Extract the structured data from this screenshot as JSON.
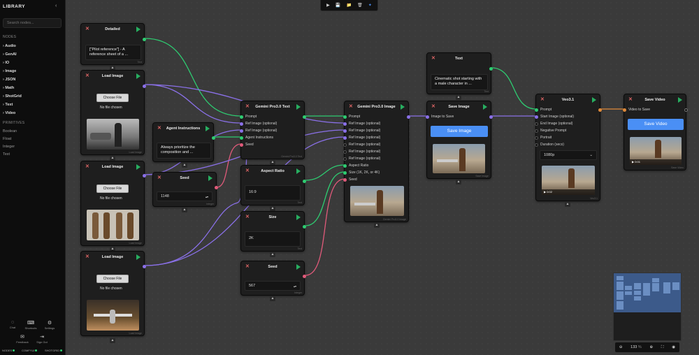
{
  "sidebar": {
    "title": "LIBRARY",
    "collapse_icon": "‹",
    "search_placeholder": "Search nodes...",
    "nodes_heading": "NODES",
    "items": [
      "Audio",
      "GenAI",
      "IO",
      "Image",
      "JSON",
      "Math",
      "ShotGrid",
      "Text",
      "Video"
    ],
    "primitives_heading": "PRIMITIVES",
    "primitives": [
      "Boolean",
      "Float",
      "Integer",
      "Text"
    ],
    "footer": [
      {
        "label": "Chat",
        "icon": "chat-icon"
      },
      {
        "label": "Shortcuts",
        "icon": "keyboard-icon"
      },
      {
        "label": "Settings",
        "icon": "gear-icon"
      },
      {
        "label": "Feedback",
        "icon": "megaphone-icon"
      },
      {
        "label": "Sign Out",
        "icon": "sign-out-icon"
      }
    ],
    "status": [
      "NODES",
      "COMFYUI",
      "SHOTGRID"
    ]
  },
  "toolbar": {
    "buttons": [
      "▶",
      "💾",
      "📁",
      "🗑",
      "✦"
    ]
  },
  "nodes": {
    "detailed": {
      "title": "Detailed",
      "text": "[\"Pilot reference\"] - A reference sheet of a ...",
      "footer": "Text"
    },
    "load1": {
      "title": "Load Image",
      "choose": "Choose File",
      "nofile": "No file chosen",
      "footer": "Load Image"
    },
    "agent": {
      "title": "Agent Instructions",
      "text": "Always prioritize the composition and ..."
    },
    "load2": {
      "title": "Load Image",
      "choose": "Choose File",
      "nofile": "No file chosen",
      "footer": "Load Image"
    },
    "seed1": {
      "title": "Seed",
      "value": "1148",
      "footer": "Integer"
    },
    "load3": {
      "title": "Load Image",
      "choose": "Choose File",
      "nofile": "No file chosen",
      "footer": "Load Image"
    },
    "gtext": {
      "title": "Gemini Pro3.0 Text",
      "ports": [
        "Prompt",
        "Ref Image (optional)",
        "Ref Image (optional)",
        "Agent Instructions",
        "Seed"
      ],
      "footer": "Gemini Pro3.0 Text"
    },
    "aspect": {
      "title": "Aspect Ratio",
      "value": "16:9",
      "footer": "Text"
    },
    "size": {
      "title": "Size",
      "value": "2K",
      "footer": "Text"
    },
    "seed2": {
      "title": "Seed",
      "value": "567",
      "footer": "Integer"
    },
    "gimage": {
      "title": "Gemini Pro3.0 Image",
      "ports": [
        "Prompt",
        "Ref Image (optional)",
        "Ref Image (optional)",
        "Ref Image (optional)",
        "Ref Image (optional)",
        "Ref Image (optional)",
        "Ref Image (optional)",
        "Aspect Ratio",
        "Size (1K, 2K, or 4K)",
        "Seed"
      ],
      "footer": "Gemini Pro3.0 Image"
    },
    "text": {
      "title": "Text",
      "text": "Cinematic shot starting with a male character in ...",
      "footer": "Text"
    },
    "saveimg": {
      "title": "Save Image",
      "port": "Image to Save",
      "button": "Save Image",
      "footer": "Save Image"
    },
    "veo": {
      "title": "Veo3.1",
      "ports": [
        "Prompt",
        "Start Image (optional)",
        "End Image (optional)",
        "Negative Prompt",
        "Portrait",
        "Duration (secs)"
      ],
      "select": "1080p",
      "time": "0:02",
      "footer": "Veo3.1"
    },
    "savevid": {
      "title": "Save Video",
      "port": "Video to Save",
      "button": "Save Video",
      "time": "0:01",
      "footer": "Save Video"
    }
  },
  "zoom": {
    "value": "133",
    "unit": "%"
  },
  "colors": {
    "green": "#2ecc71",
    "purple": "#8a70e8",
    "red": "#e05a7a",
    "orange": "#e08a3a",
    "blue_button": "#4a8ff5"
  }
}
